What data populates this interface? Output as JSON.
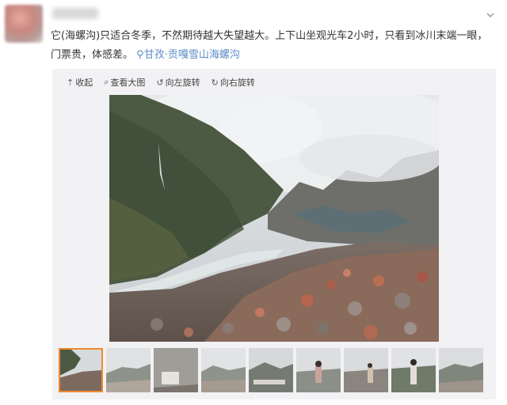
{
  "post": {
    "text": "它(海螺沟)只适合冬季，不然期待越大失望越大。上下山坐观光车2小时，只看到冰川末端一眼，门票贵，体感差。",
    "location_icon": "location-pin-icon",
    "location": "甘孜·贡嘎雪山海螺沟"
  },
  "toolbar": {
    "collapse_label": "收起",
    "view_large_label": "查看大图",
    "rotate_left_label": "向左旋转",
    "rotate_right_label": "向右旋转"
  },
  "gallery": {
    "thumbnail_count": 9,
    "selected_index": 0
  },
  "colors": {
    "link": "#5b8bc7",
    "selected_border": "#f08a2e",
    "media_background": "#f2f2f5"
  }
}
